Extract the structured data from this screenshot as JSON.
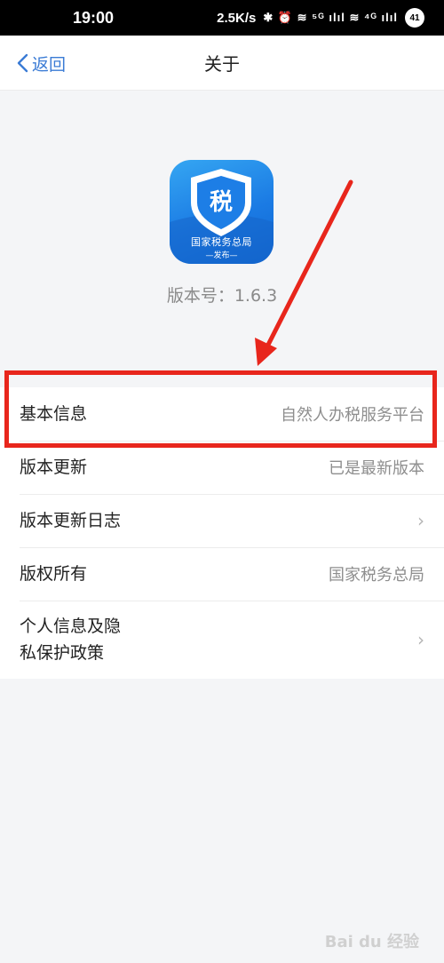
{
  "status_bar": {
    "time": "19:00",
    "speed": "2.5K/s",
    "icons": "✱ ⏰ ≋ ⁵ᴳ ılıl ≋ ⁴ᴳ ılıl",
    "battery": "41"
  },
  "nav": {
    "back_label": "返回",
    "title": "关于"
  },
  "app_logo": {
    "line1": "国家税务总局",
    "line2": "—发布—",
    "glyph": "税"
  },
  "version_text": "版本号：1.6.3",
  "list": [
    {
      "label": "基本信息",
      "value": "自然人办税服务平台"
    },
    {
      "label": "版本更新",
      "value": "已是最新版本"
    },
    {
      "label": "版本更新日志",
      "value": "›"
    },
    {
      "label": "版权所有",
      "value": "国家税务总局"
    },
    {
      "label": "个人信息及隐\n私保护政策",
      "value": "›"
    }
  ],
  "watermark": "Bai du 经验",
  "colors": {
    "accent": "#3a7bd5",
    "highlight": "#e8261c",
    "logo_blue": "#1b7be4"
  }
}
